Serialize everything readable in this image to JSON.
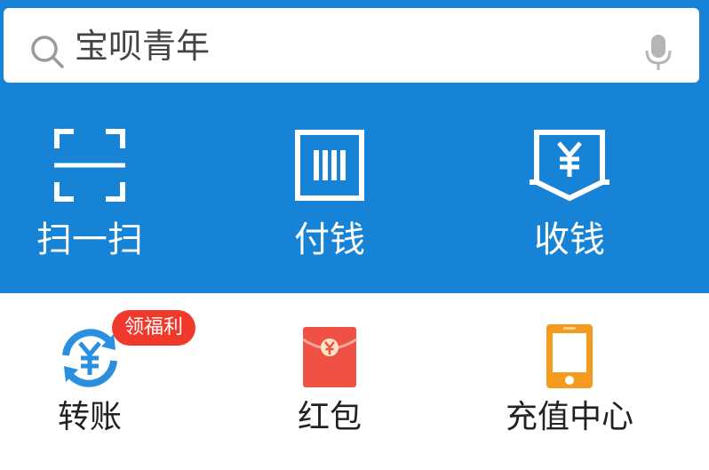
{
  "search": {
    "query": "宝呗青年"
  },
  "actions": [
    {
      "label": "扫一扫",
      "icon": "scan-icon"
    },
    {
      "label": "付钱",
      "icon": "barcode-pay-icon"
    },
    {
      "label": "收钱",
      "icon": "receive-money-icon"
    }
  ],
  "services": [
    {
      "label": "转账",
      "icon": "transfer-icon",
      "badge": "领福利"
    },
    {
      "label": "红包",
      "icon": "red-envelope-icon"
    },
    {
      "label": "充值中心",
      "icon": "phone-recharge-icon"
    }
  ],
  "colors": {
    "header_blue": "#1683d6",
    "badge_red": "#f0392a",
    "transfer_blue": "#2b8fe0",
    "envelope_red": "#ef5145",
    "phone_orange": "#f39a1f"
  }
}
